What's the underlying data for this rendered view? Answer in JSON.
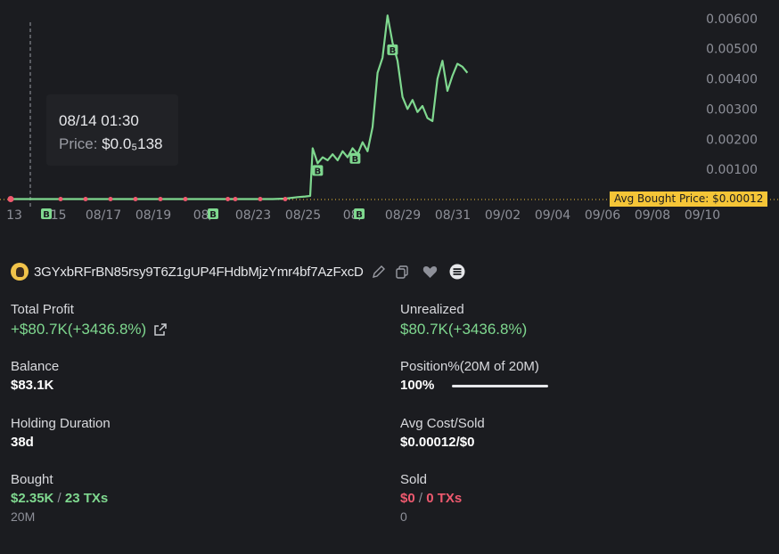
{
  "tooltip": {
    "date": "08/14 01:30",
    "price_label": "Price:",
    "price_value": "$0.0₅138"
  },
  "chart_data": {
    "type": "line",
    "y_ticks": [
      "0.00600",
      "0.00500",
      "0.00400",
      "0.00300",
      "0.00200",
      "0.00100"
    ],
    "x_ticks": [
      "13",
      "08/15",
      "08/17",
      "08/19",
      "08/21",
      "08/23",
      "08/25",
      "08/27",
      "08/29",
      "08/31",
      "09/02",
      "09/04",
      "09/06",
      "09/08",
      "09/10"
    ],
    "x_tick_display": [
      "13",
      "0⁄15",
      "08/17",
      "08/19",
      "08/",
      "08/23",
      "08/25",
      "08/",
      "08/29",
      "08/31",
      "09/02",
      "09/04",
      "09/06",
      "09/08",
      "09/10"
    ],
    "avg_bought_price_label": "Avg Bought Price: $0.00012",
    "avg_bought_price": 0.00012,
    "ylim": [
      0,
      0.0062
    ],
    "series": [
      {
        "x": [
          0,
          0.5,
          1,
          1.5,
          2,
          2.5,
          3,
          3.5,
          4,
          4.5,
          5,
          5.5,
          6,
          6.5,
          7,
          7.5,
          8,
          8.5,
          9,
          9.5,
          10,
          10.5,
          11,
          11.5,
          11.8,
          12,
          12.1,
          12.3,
          12.5,
          12.7,
          12.9,
          13.1,
          13.3,
          13.5,
          13.7,
          13.9,
          14.1,
          14.3,
          14.5,
          14.7,
          14.9,
          15.1,
          15.3,
          15.5,
          15.7,
          15.9,
          16.1,
          16.3,
          16.5,
          16.7,
          16.9,
          17.1,
          17.3,
          17.5,
          17.7,
          17.9,
          18.1,
          18.3
        ],
        "y": [
          1.4e-05,
          1.4e-05,
          1.4e-05,
          1.4e-05,
          1.4e-05,
          1.4e-05,
          1.4e-05,
          1.4e-05,
          1.4e-05,
          1.4e-05,
          1.4e-05,
          1.4e-05,
          1.4e-05,
          1.4e-05,
          1.4e-05,
          1.4e-05,
          1.4e-05,
          1.4e-05,
          1.4e-05,
          1.4e-05,
          1.4e-05,
          1.4e-05,
          3e-05,
          8e-05,
          0.0001,
          0.00012,
          0.0017,
          0.0012,
          0.0014,
          0.0013,
          0.0015,
          0.0013,
          0.0016,
          0.0014,
          0.0017,
          0.0015,
          0.0019,
          0.0016,
          0.0024,
          0.0042,
          0.0047,
          0.0061,
          0.0052,
          0.0046,
          0.0034,
          0.003,
          0.0033,
          0.0029,
          0.0031,
          0.0027,
          0.0026,
          0.004,
          0.0046,
          0.0036,
          0.0041,
          0.0045,
          0.0044,
          0.0042
        ]
      }
    ],
    "buy_markers_x": [
      1,
      4.5,
      8,
      12.3,
      13.8,
      15.3
    ],
    "sell_markers_x": [
      0,
      2,
      3,
      4,
      5,
      6,
      7,
      8.7,
      9,
      10,
      11
    ]
  },
  "wallet": {
    "address": "3GYxbRFrBN85rsy9T6Z1gUP4FHdbMjzYmr4bf7AzFxcD"
  },
  "stats": {
    "total_profit": {
      "label": "Total Profit",
      "value": "+$80.7K(+3436.8%)"
    },
    "unrealized": {
      "label": "Unrealized",
      "value": "$80.7K(+3436.8%)"
    },
    "balance": {
      "label": "Balance",
      "value": "$83.1K"
    },
    "position": {
      "label": "Position%(20M of 20M)",
      "value": "100%",
      "fraction": 1.0
    },
    "holding_duration": {
      "label": "Holding Duration",
      "value": "38d"
    },
    "avg_cost": {
      "label": "Avg Cost/Sold",
      "value": "$0.00012/$0"
    },
    "bought": {
      "label": "Bought",
      "amount": "$2.35K",
      "sep": "/",
      "txs": "23 TXs",
      "sub": "20M"
    },
    "sold": {
      "label": "Sold",
      "amount": "$0",
      "sep": "/",
      "txs": "0 TXs",
      "sub": "0"
    }
  },
  "colors": {
    "line": "#7fd88f",
    "sell_dot": "#ef5a6f",
    "avg_label_bg": "#f5c537",
    "background": "#1b1c20"
  }
}
